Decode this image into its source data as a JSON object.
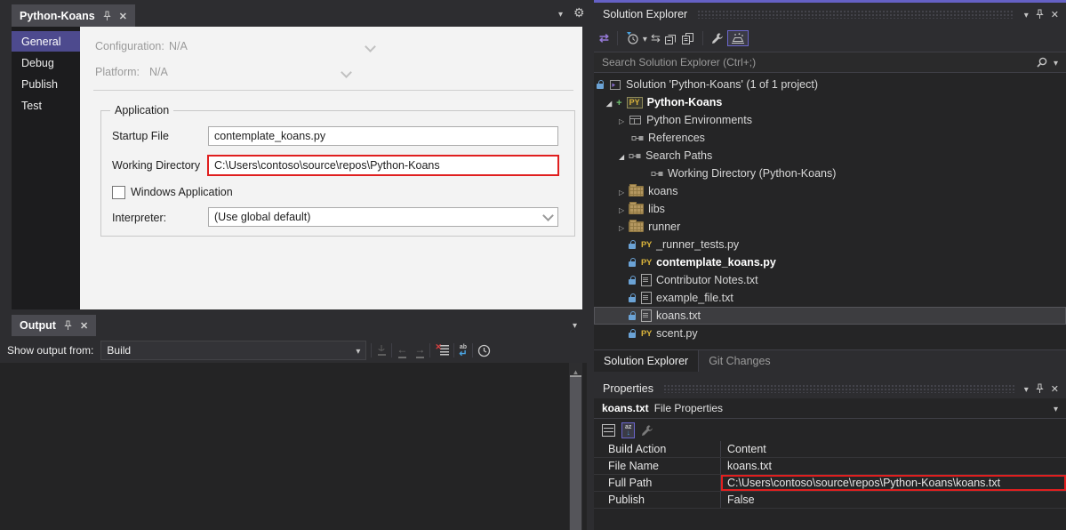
{
  "window": {
    "accent_color": "#6561c5",
    "highlight_color": "#e01f1f"
  },
  "editor": {
    "tab_title": "Python-Koans",
    "nav_items": [
      {
        "label": "General",
        "selected": true
      },
      {
        "label": "Debug",
        "selected": false
      },
      {
        "label": "Publish",
        "selected": false
      },
      {
        "label": "Test",
        "selected": false
      }
    ],
    "form": {
      "configuration_label": "Configuration:",
      "configuration_value": "N/A",
      "platform_label": "Platform:",
      "platform_value": "N/A",
      "application_group_title": "Application",
      "startup_file_label": "Startup File",
      "startup_file_value": "contemplate_koans.py",
      "working_directory_label": "Working Directory",
      "working_directory_value": "C:\\Users\\contoso\\source\\repos\\Python-Koans",
      "working_directory_highlighted": true,
      "windows_application_label": "Windows Application",
      "windows_application_checked": false,
      "interpreter_label": "Interpreter:",
      "interpreter_value": "(Use global default)"
    }
  },
  "output_panel": {
    "tab_title": "Output",
    "show_output_from_label": "Show output from:",
    "source_value": "Build"
  },
  "solution_explorer": {
    "title": "Solution Explorer",
    "search_placeholder": "Search Solution Explorer (Ctrl+;)",
    "py_badge": "PY",
    "tree": [
      {
        "label": "Solution 'Python-Koans' (1 of 1 project)",
        "locked": true
      },
      {
        "label": "Python-Koans",
        "bold": true,
        "expanded": true
      },
      {
        "label": "Python Environments",
        "collapsed": true
      },
      {
        "label": "References"
      },
      {
        "label": "Search Paths",
        "expanded": true
      },
      {
        "label": "Working Directory (Python-Koans)"
      },
      {
        "label": "koans",
        "collapsed": true
      },
      {
        "label": "libs",
        "collapsed": true
      },
      {
        "label": "runner",
        "collapsed": true
      },
      {
        "label": "_runner_tests.py",
        "locked": true
      },
      {
        "label": "contemplate_koans.py",
        "locked": true,
        "bold": true
      },
      {
        "label": "Contributor Notes.txt",
        "locked": true
      },
      {
        "label": "example_file.txt",
        "locked": true
      },
      {
        "label": "koans.txt",
        "locked": true,
        "selected": true
      },
      {
        "label": "scent.py",
        "locked": true
      }
    ],
    "bottom_tabs": [
      {
        "label": "Solution Explorer",
        "active": true
      },
      {
        "label": "Git Changes",
        "active": false
      }
    ]
  },
  "properties_panel": {
    "title": "Properties",
    "object_name": "koans.txt",
    "object_kind": "File Properties",
    "rows": [
      {
        "label": "Build Action",
        "value": "Content",
        "highlighted": false
      },
      {
        "label": "File Name",
        "value": "koans.txt",
        "highlighted": false
      },
      {
        "label": "Full Path",
        "value": "C:\\Users\\contoso\\source\\repos\\Python-Koans\\koans.txt",
        "highlighted": true
      },
      {
        "label": "Publish",
        "value": "False",
        "highlighted": false
      }
    ]
  }
}
